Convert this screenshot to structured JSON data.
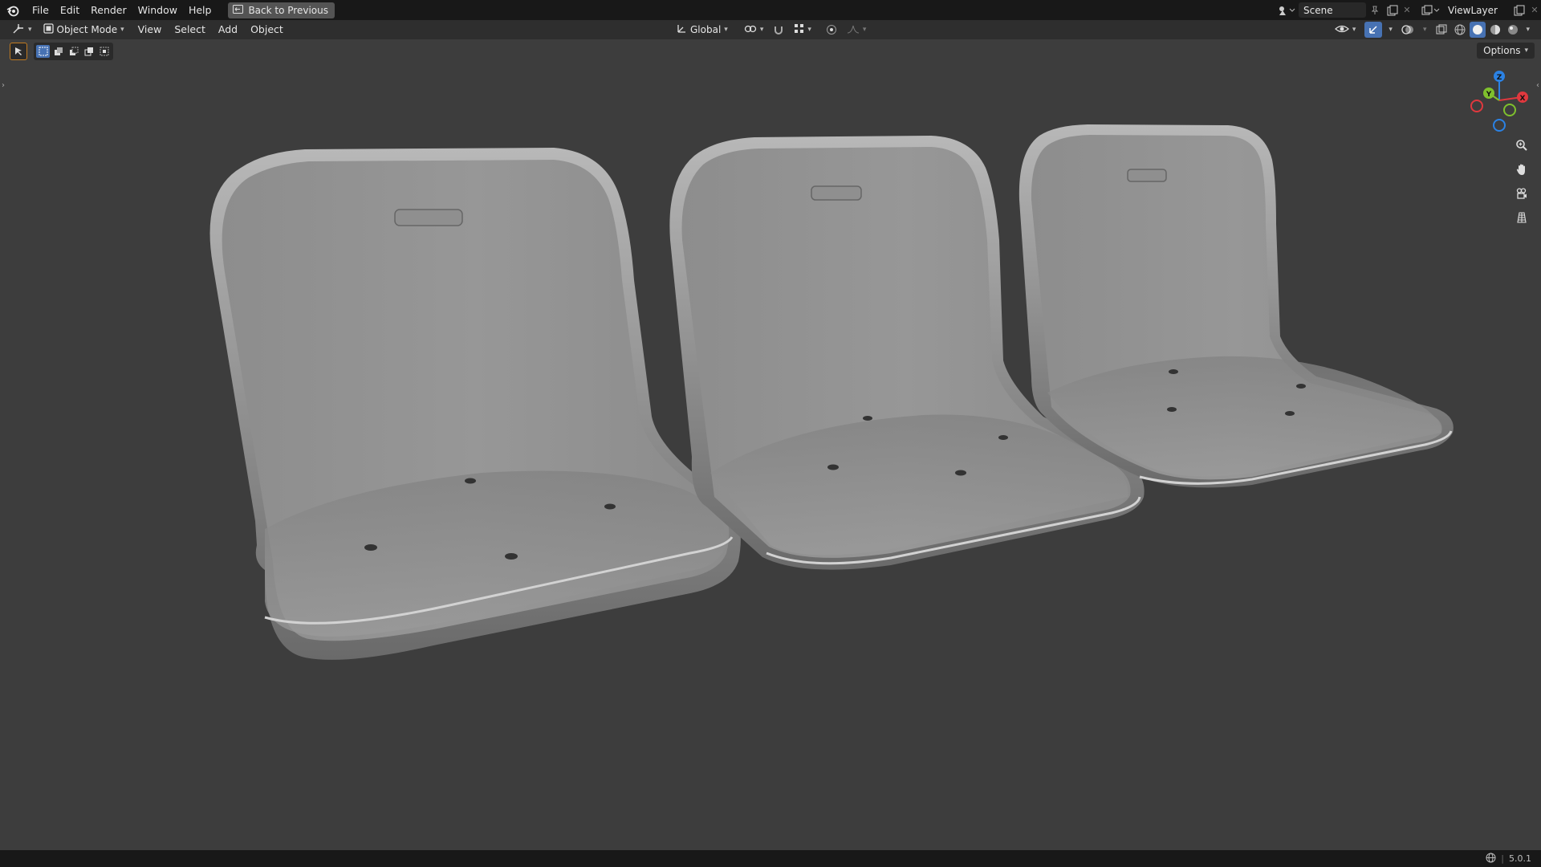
{
  "topbar": {
    "menus": [
      "File",
      "Edit",
      "Render",
      "Window",
      "Help"
    ],
    "back_label": "Back to Previous",
    "scene_name": "Scene",
    "view_layer": "ViewLayer"
  },
  "header": {
    "mode": "Object Mode",
    "menus": [
      "View",
      "Select",
      "Add",
      "Object"
    ],
    "orientation": "Global"
  },
  "viewport": {
    "options_label": "Options",
    "gizmo_axes": {
      "x": "X",
      "y": "Y",
      "z": "Z"
    },
    "objects": [
      "bus-seat-1",
      "bus-seat-2",
      "bus-seat-3"
    ]
  },
  "statusbar": {
    "version": "5.0.1"
  },
  "colors": {
    "axis_x": "#e0383e",
    "axis_y": "#7fc02d",
    "axis_z": "#2b82e4",
    "accent": "#4772b3",
    "background": "#3d3d3d"
  }
}
